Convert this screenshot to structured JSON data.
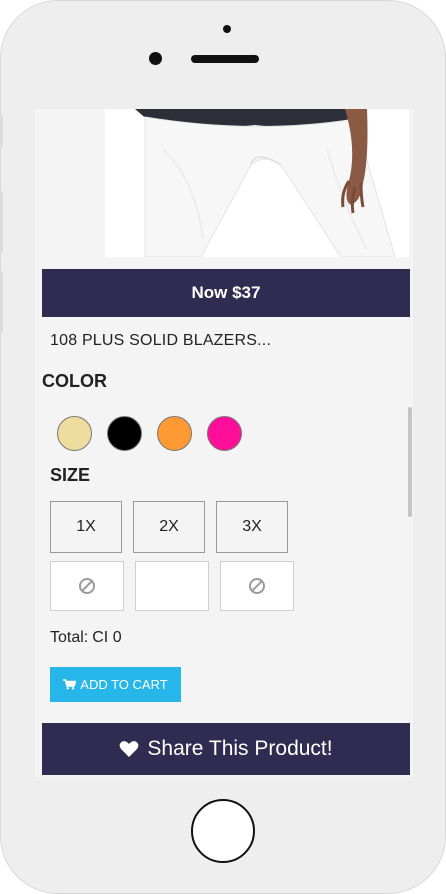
{
  "product": {
    "price_label": "Now $37",
    "name": "108 PLUS SOLID BLAZERS..."
  },
  "color": {
    "heading": "COLOR",
    "swatches": [
      {
        "name": "beige",
        "hex": "#eedd9e"
      },
      {
        "name": "black",
        "hex": "#000000"
      },
      {
        "name": "orange",
        "hex": "#ff9933"
      },
      {
        "name": "pink",
        "hex": "#ff0f99"
      }
    ]
  },
  "size": {
    "heading": "SIZE",
    "options": [
      {
        "label": "1X",
        "available": false
      },
      {
        "label": "2X",
        "available": true
      },
      {
        "label": "3X",
        "available": false
      }
    ]
  },
  "total": {
    "label": "Total:",
    "value": "CI 0"
  },
  "cart": {
    "add_label": "ADD TO CART",
    "icon": "cart-icon"
  },
  "share": {
    "label": "Share This Product!",
    "icon": "heart-icon"
  },
  "theme": {
    "primary": "#302b50",
    "accent": "#27b6ea"
  }
}
